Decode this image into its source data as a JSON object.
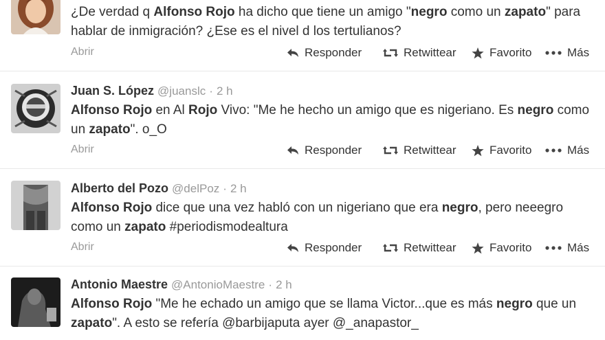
{
  "tweets": [
    {
      "name": "",
      "handle": "",
      "dot": "",
      "time": "",
      "segments": [
        {
          "t": "¿De verdad q ",
          "b": false
        },
        {
          "t": "Alfonso Rojo",
          "b": true
        },
        {
          "t": " ha dicho que tiene un amigo \"",
          "b": false
        },
        {
          "t": "negro",
          "b": true
        },
        {
          "t": " como un ",
          "b": false
        },
        {
          "t": "zapato",
          "b": true
        },
        {
          "t": "\" para hablar de inmigración? ¿Ese es el nivel d los tertulianos?",
          "b": false
        }
      ],
      "avatar_colors": [
        "#b5774f",
        "#e9d2c1"
      ]
    },
    {
      "name": "Juan S. López",
      "handle": "@juanslc",
      "dot": "·",
      "time": "2 h",
      "segments": [
        {
          "t": "Alfonso Rojo",
          "b": true
        },
        {
          "t": " en Al ",
          "b": false
        },
        {
          "t": "Rojo",
          "b": true
        },
        {
          "t": " Vivo: \"Me he hecho un amigo que es nigeriano. Es ",
          "b": false
        },
        {
          "t": "negro",
          "b": true
        },
        {
          "t": " como un ",
          "b": false
        },
        {
          "t": "zapato",
          "b": true
        },
        {
          "t": "\". o_O",
          "b": false
        }
      ],
      "avatar_colors": [
        "#3c3c3c",
        "#d8d8d8"
      ]
    },
    {
      "name": "Alberto del Pozo",
      "handle": "@delPoz",
      "dot": "·",
      "time": "2 h",
      "segments": [
        {
          "t": "Alfonso Rojo",
          "b": true
        },
        {
          "t": " dice que una vez habló con un nigeriano que era ",
          "b": false
        },
        {
          "t": "negro",
          "b": true
        },
        {
          "t": ", pero neeegro como un ",
          "b": false
        },
        {
          "t": "zapato",
          "b": true
        },
        {
          "t": " #periodismodealtura",
          "b": false
        }
      ],
      "avatar_colors": [
        "#6a6a6a",
        "#c9c9c9"
      ]
    },
    {
      "name": "Antonio Maestre",
      "handle": "@AntonioMaestre",
      "dot": "·",
      "time": "2 h",
      "segments": [
        {
          "t": "Alfonso Rojo",
          "b": true
        },
        {
          "t": " \"Me he echado un amigo que se llama Victor...que es más ",
          "b": false
        },
        {
          "t": "negro",
          "b": true
        },
        {
          "t": " que un ",
          "b": false
        },
        {
          "t": "zapato",
          "b": true
        },
        {
          "t": "\". A esto se refería @barbijaputa ayer @_anapastor_",
          "b": false
        }
      ],
      "avatar_colors": [
        "#1e1e1e",
        "#8a8a8a"
      ]
    }
  ],
  "actions": {
    "open": "Abrir",
    "reply": "Responder",
    "retweet": "Retwittear",
    "favorite": "Favorito",
    "more": "Más"
  },
  "icons": {
    "reply": "reply-arrow-icon",
    "retweet": "retweet-icon",
    "favorite": "star-icon",
    "more": "ellipsis-icon"
  }
}
